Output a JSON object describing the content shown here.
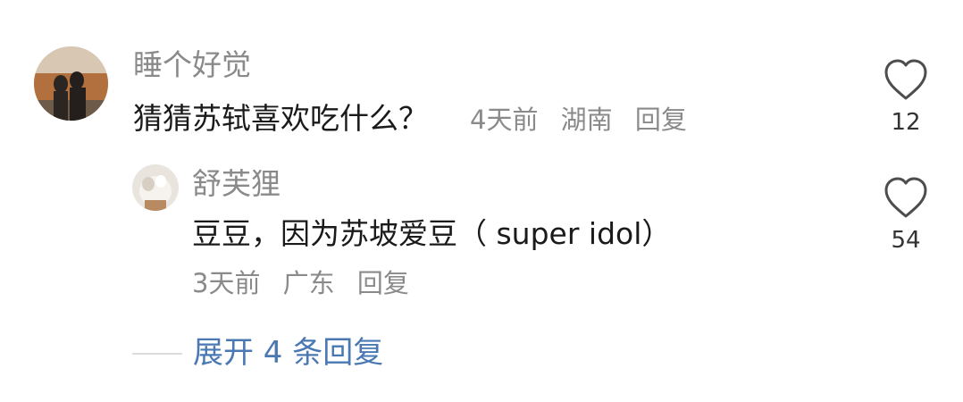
{
  "comment": {
    "username": "睡个好觉",
    "text": "猜猜苏轼喜欢吃什么？",
    "time": "4天前",
    "location": "湖南",
    "reply_label": "回复",
    "likes": "12"
  },
  "reply": {
    "username": "舒芙狸",
    "text": "豆豆，因为苏坡爱豆（ super idol）",
    "time": "3天前",
    "location": "广东",
    "reply_label": "回复",
    "likes": "54"
  },
  "expand_label": "展开 4 条回复",
  "colors": {
    "meta_gray": "#8a8a8a",
    "link_blue": "#4a78b3",
    "text_dark": "#1a1a1a"
  }
}
